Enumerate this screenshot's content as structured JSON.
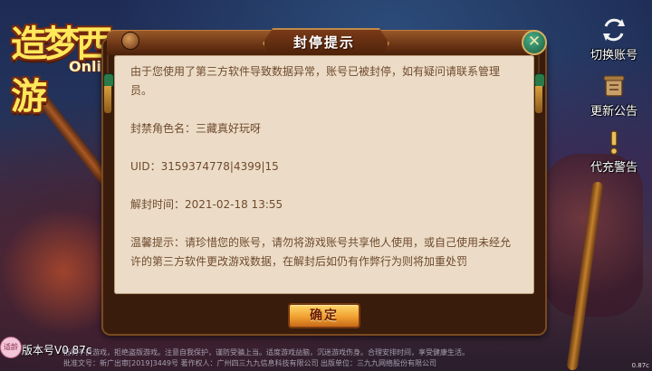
{
  "logo": {
    "main": "造梦西游",
    "sub": "Online"
  },
  "side_buttons": [
    {
      "label": "切换账号",
      "icon": "switch-account-icon"
    },
    {
      "label": "更新公告",
      "icon": "scroll-announcement-icon"
    },
    {
      "label": "代充警告",
      "icon": "exclamation-warning-icon"
    }
  ],
  "dialog": {
    "title": "封停提示",
    "message": "由于您使用了第三方软件导致数据异常，账号已被封停，如有疑问请联系管理员。",
    "role_line": "封禁角色名：三藏真好玩呀",
    "uid_line": "UID：3159374778|4399|15",
    "unban_line": "解封时间：2021-02-18 13:55",
    "tip_line": "温馨提示：请珍惜您的账号，请勿将游戏账号共享他人使用，或自己使用未经允许的第三方软件更改游戏数据，在解封后如仍有作弊行为则将加重处罚",
    "ok_label": "确定",
    "close_symbol": "✕"
  },
  "footer": {
    "version": "版本号V0.87c",
    "age_badge": "适龄",
    "legal_line1": "抵制不良游戏，拒绝盗版游戏。注意自我保护，谨防受骗上当。适度游戏益脑，沉迷游戏伤身。合理安排时间，享受健康生活。",
    "legal_line2": "批准文号：新广出审[2019]3449号 著作权人：广州四三九九信息科技有限公司 出版单位：三九九网络股份有限公司",
    "corner_version": "0.87c"
  },
  "colors": {
    "panel_bg": "#ecdcc7",
    "text_brown": "#6e4a2e",
    "button_orange": "#f0a030",
    "frame_dark": "#3a1c0c"
  }
}
